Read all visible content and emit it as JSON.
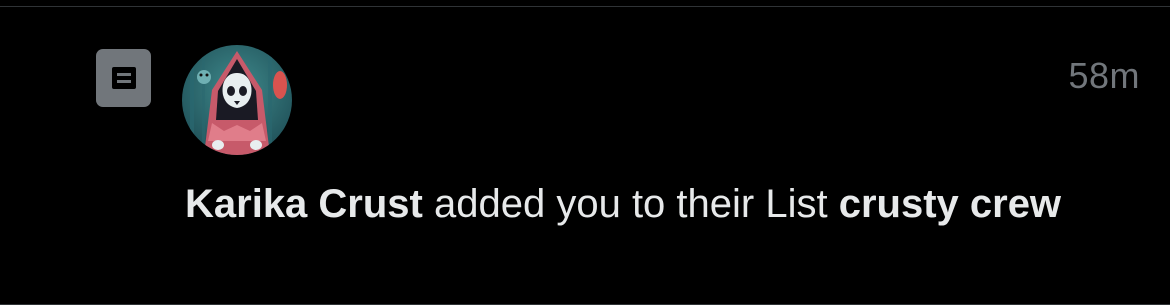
{
  "notification": {
    "type_icon": "list-icon",
    "avatar_icon": "avatar-hooded-figure",
    "timestamp": "58m",
    "actor_name": "Karika Crust",
    "action_text": " added you to their List ",
    "list_name": "crusty crew"
  },
  "colors": {
    "background": "#000000",
    "primary_text": "#e7e9ea",
    "secondary_text": "#71767b",
    "icon_bg": "#71767b",
    "divider": "#2f3336"
  }
}
